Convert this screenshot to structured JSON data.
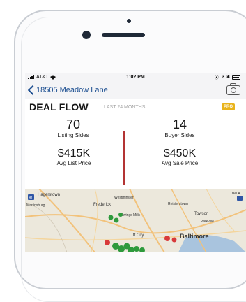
{
  "status": {
    "carrier": "AT&T",
    "time": "1:02 PM"
  },
  "nav": {
    "title": "18505 Meadow Lane"
  },
  "header": {
    "title": "DEAL FLOW",
    "subtitle": "LAST 24 MONTHS",
    "badge": "PRO"
  },
  "stats": {
    "listing_sides": {
      "value": "70",
      "label": "Listing Sides"
    },
    "buyer_sides": {
      "value": "14",
      "label": "Buyer Sides"
    },
    "avg_list_price": {
      "value": "$415K",
      "label": "Avg List Price"
    },
    "avg_sale_price": {
      "value": "$450K",
      "label": "Avg Sale Price"
    }
  },
  "map": {
    "cities": {
      "hagerstown": "Hagerstown",
      "westminster": "Westminster",
      "martinsburg": "Martinsburg",
      "frederick": "Frederick",
      "reisterstown": "Reisterstown",
      "owings_mills": "Owings Mills",
      "towson": "Towson",
      "parkville": "Parkville",
      "ellicott_city": "tt City",
      "baltimore": "Baltimore",
      "bel_air": "Bel A",
      "route_shield": "81"
    },
    "colors": {
      "green_pin": "#2e9a3c",
      "red_pin": "#d83a3a",
      "water": "#a9c4de"
    }
  }
}
